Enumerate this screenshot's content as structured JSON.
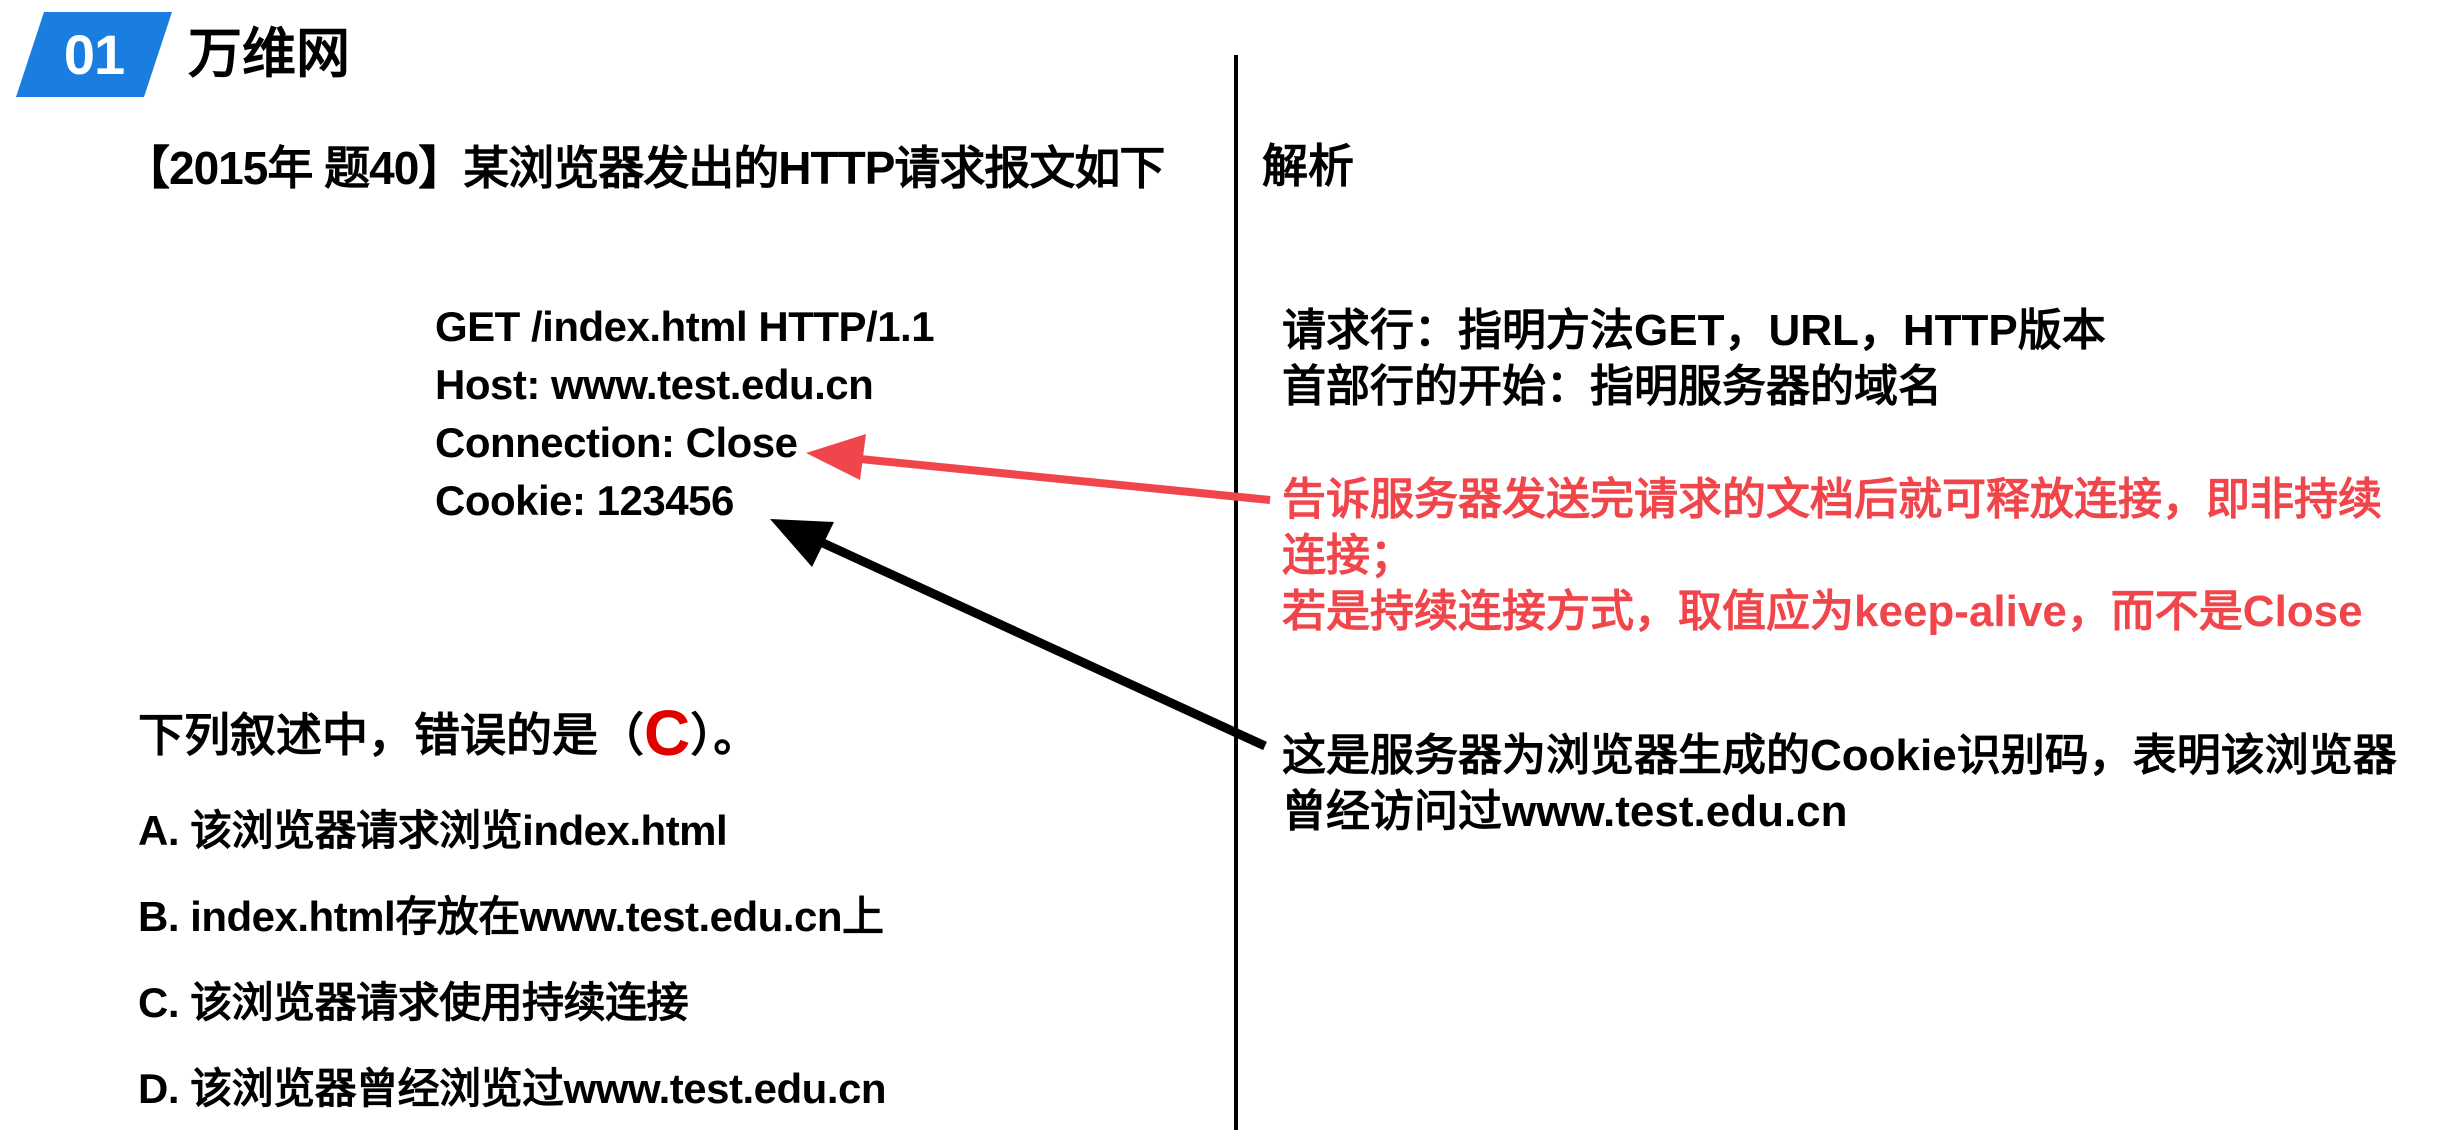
{
  "header": {
    "number": "01",
    "title": "万维网"
  },
  "question": {
    "title": "【2015年 题40】某浏览器发出的HTTP请求报文如下",
    "request_lines": [
      "GET /index.html HTTP/1.1",
      "Host: www.test.edu.cn",
      "Connection: Close",
      "Cookie: 123456"
    ],
    "prompt_prefix": "下列叙述中，错误的是（",
    "answer": "C",
    "prompt_suffix": "）。",
    "options": [
      "A. 该浏览器请求浏览index.html",
      "B. index.html存放在www.test.edu.cn上",
      "C. 该浏览器请求使用持续连接",
      "D. 该浏览器曾经浏览过www.test.edu.cn"
    ]
  },
  "analysis": {
    "title": "解析",
    "block1": [
      "请求行：指明方法GET，URL，HTTP版本",
      "首部行的开始：指明服务器的域名"
    ],
    "block2": [
      "告诉服务器发送完请求的文档后就可释放连接，即非持续连接；",
      "若是持续连接方式，取值应为keep-alive，而不是Close"
    ],
    "block3": [
      "这是服务器为浏览器生成的Cookie识别码，表明该浏览器曾经访问过www.test.edu.cn"
    ]
  },
  "colors": {
    "badge_blue": "#1a7ee0",
    "highlight_red": "#f0454a",
    "answer_red": "#e00000"
  }
}
